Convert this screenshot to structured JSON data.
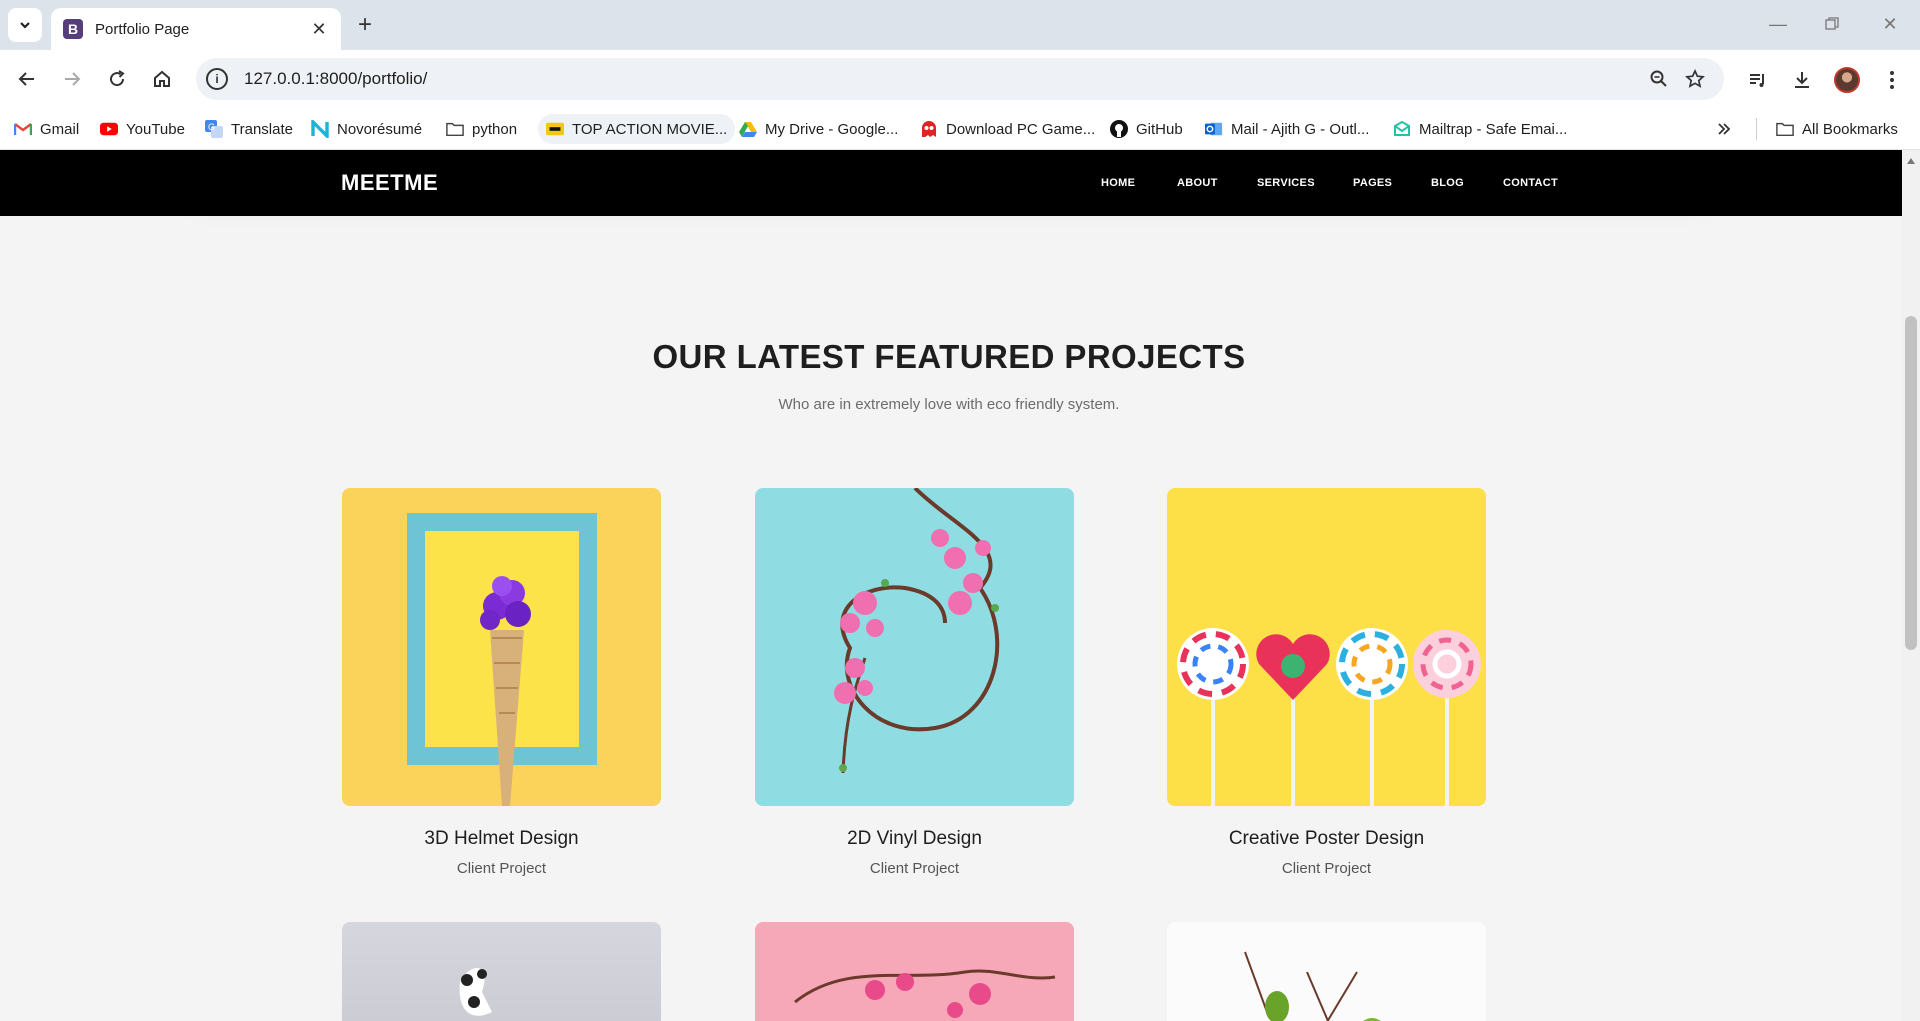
{
  "browser": {
    "tab_title": "Portfolio Page",
    "url": "127.0.0.1:8000/portfolio/",
    "bookmarks": [
      "Gmail",
      "YouTube",
      "Translate",
      "Novorésumé",
      "python",
      "TOP ACTION MOVIE...",
      "My Drive - Google...",
      "Download PC Game...",
      "GitHub",
      "Mail - Ajith G - Outl...",
      "Mailtrap - Safe Emai..."
    ],
    "all_bookmarks": "All Bookmarks"
  },
  "site": {
    "brand": "MEETME",
    "menu": [
      "HOME",
      "ABOUT",
      "SERVICES",
      "PAGES",
      "BLOG",
      "CONTACT"
    ]
  },
  "section": {
    "title": "OUR LATEST FEATURED PROJECTS",
    "subtitle": "Who are in extremely love with eco friendly system."
  },
  "projects": [
    {
      "name": "3D Helmet Design",
      "type": "Client Project",
      "bg": "#fcd35a"
    },
    {
      "name": "2D Vinyl Design",
      "type": "Client Project",
      "bg": "#8fdde3"
    },
    {
      "name": "Creative Poster Design",
      "type": "Client Project",
      "bg": "#fde047"
    }
  ]
}
